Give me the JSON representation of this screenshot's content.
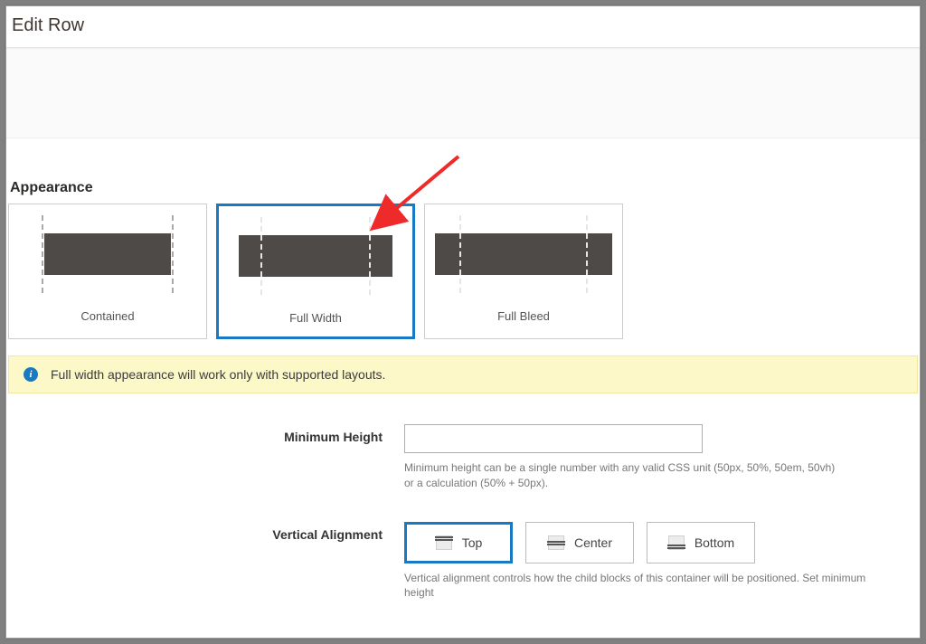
{
  "title": "Edit Row",
  "appearance": {
    "section_label": "Appearance",
    "options": [
      {
        "label": "Contained"
      },
      {
        "label": "Full Width"
      },
      {
        "label": "Full Bleed"
      }
    ],
    "selected_index": 1,
    "info_message": "Full width appearance will work only with supported layouts."
  },
  "min_height": {
    "label": "Minimum Height",
    "value": "",
    "help": "Minimum height can be a single number with any valid CSS unit (50px, 50%, 50em, 50vh) or a calculation (50% + 50px)."
  },
  "vertical_alignment": {
    "label": "Vertical Alignment",
    "options": [
      {
        "label": "Top"
      },
      {
        "label": "Center"
      },
      {
        "label": "Bottom"
      }
    ],
    "selected_index": 0,
    "help": "Vertical alignment controls how the child blocks of this container will be positioned. Set minimum height"
  }
}
